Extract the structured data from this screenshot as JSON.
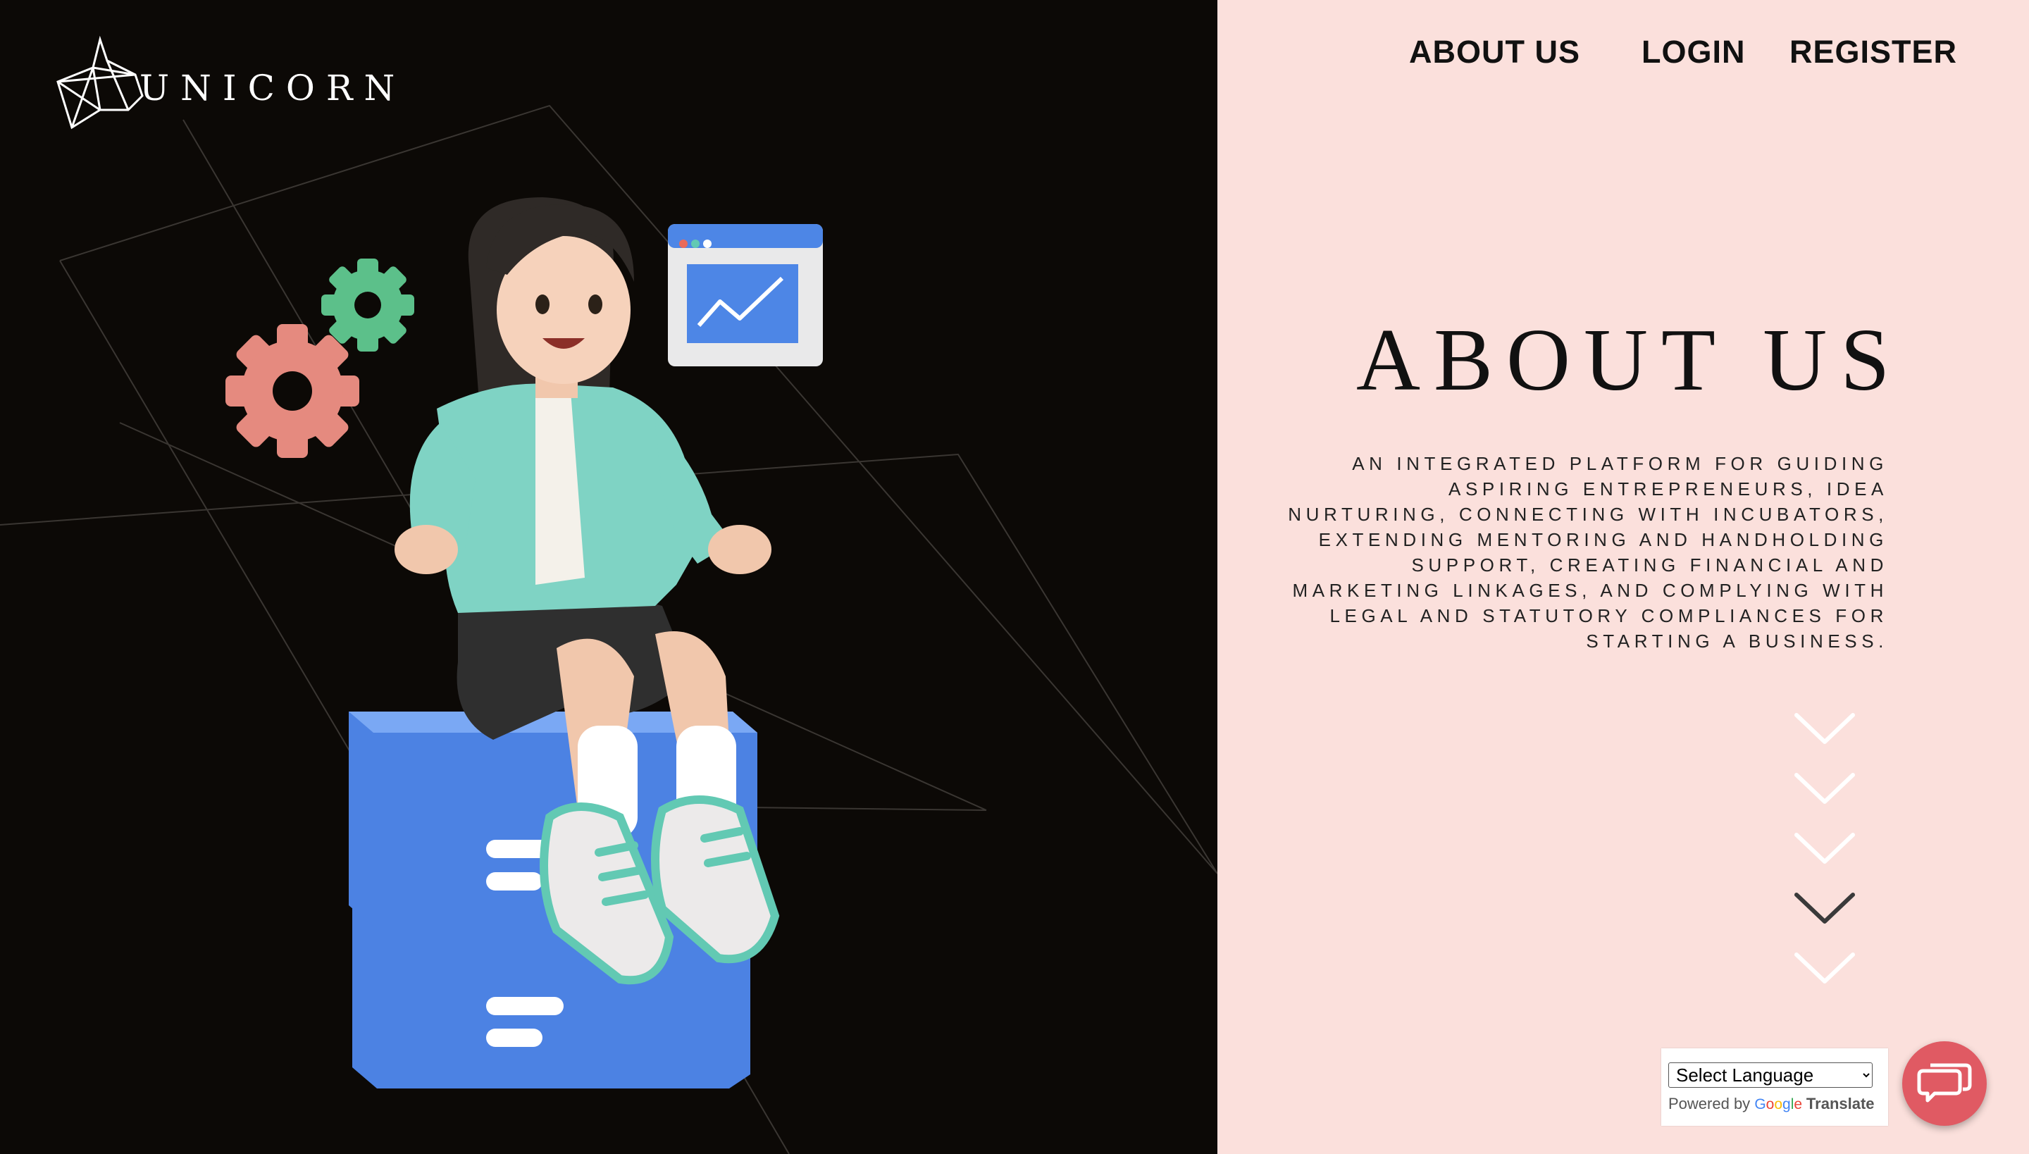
{
  "brand": {
    "name": "UNICORN"
  },
  "nav": {
    "about": "ABOUT US",
    "login": "LOGIN",
    "register": "REGISTER"
  },
  "about": {
    "title": "ABOUT US",
    "description": "AN INTEGRATED PLATFORM FOR GUIDING ASPIRING ENTREPRENEURS, IDEA NURTURING, CONNECTING WITH INCUBATORS, EXTENDING MENTORING AND HANDHOLDING SUPPORT, CREATING FINANCIAL AND MARKETING LINKAGES, AND COMPLYING WITH LEGAL AND STATUTORY COMPLIANCES FOR STARTING A BUSINESS."
  },
  "translate": {
    "select_label": "Select Language",
    "powered_by": "Powered by",
    "google": "Google",
    "translate": "Translate"
  },
  "colors": {
    "left_bg": "#0c0906",
    "right_bg": "#fbe0dc",
    "chat_button": "#e05a63",
    "accent_blue": "#4d86e6",
    "accent_mint": "#62c9b3"
  },
  "icons": {
    "scroll_indicator": "chevron-down-icon",
    "chat": "chat-bubbles-icon"
  }
}
